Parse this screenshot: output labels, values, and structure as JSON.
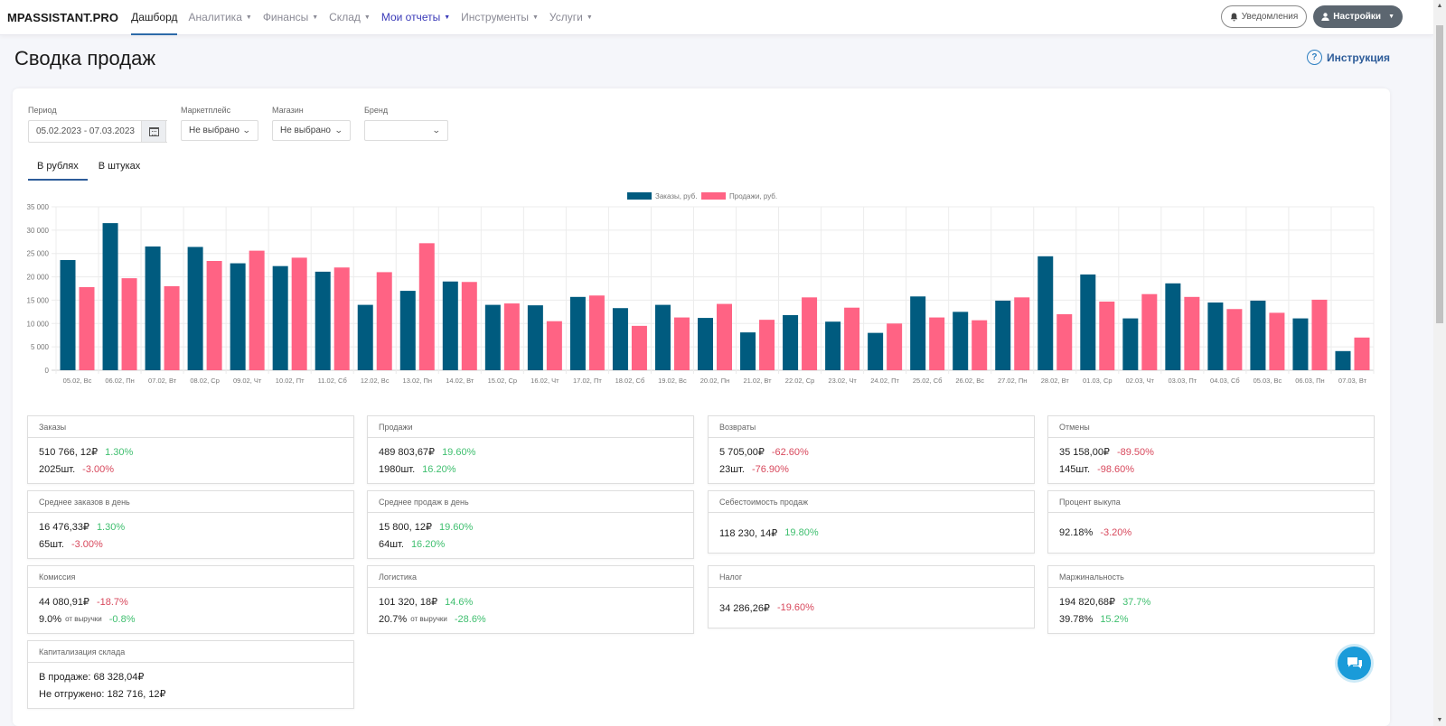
{
  "navbar": {
    "brand": "MPASSISTANT.PRO",
    "items": [
      {
        "label": "Дашборд",
        "dropdown": false,
        "state": "active"
      },
      {
        "label": "Аналитика",
        "dropdown": true,
        "state": ""
      },
      {
        "label": "Финансы",
        "dropdown": true,
        "state": ""
      },
      {
        "label": "Склад",
        "dropdown": true,
        "state": ""
      },
      {
        "label": "Мои отчеты",
        "dropdown": true,
        "state": "highlight"
      },
      {
        "label": "Инструменты",
        "dropdown": true,
        "state": ""
      },
      {
        "label": "Услуги",
        "dropdown": true,
        "state": ""
      }
    ],
    "notifications_label": "Уведомления",
    "settings_label": "Настройки"
  },
  "page": {
    "title": "Сводка продаж",
    "help_label": "Инструкция"
  },
  "filters": {
    "period_label": "Период",
    "period_value": "05.02.2023 - 07.03.2023",
    "marketplace_label": "Маркетплейс",
    "marketplace_value": "Не выбрано",
    "shop_label": "Магазин",
    "shop_value": "Не выбрано",
    "brand_label": "Бренд",
    "brand_value": ""
  },
  "tabs": [
    {
      "label": "В рублях",
      "active": true
    },
    {
      "label": "В штуках",
      "active": false
    }
  ],
  "chart_data": {
    "type": "bar",
    "title": "",
    "xlabel": "",
    "ylabel": "",
    "ylim": [
      0,
      35000
    ],
    "yticks": [
      0,
      5000,
      10000,
      15000,
      20000,
      25000,
      30000,
      35000
    ],
    "ytick_labels": [
      "0",
      "5 000",
      "10 000",
      "15 000",
      "20 000",
      "25 000",
      "30 000",
      "35 000"
    ],
    "grid": true,
    "legend_position": "top-center",
    "categories": [
      "05.02, Вс",
      "06.02, Пн",
      "07.02, Вт",
      "08.02, Ср",
      "09.02, Чт",
      "10.02, Пт",
      "11.02, Сб",
      "12.02, Вс",
      "13.02, Пн",
      "14.02, Вт",
      "15.02, Ср",
      "16.02, Чт",
      "17.02, Пт",
      "18.02, Сб",
      "19.02, Вс",
      "20.02, Пн",
      "21.02, Вт",
      "22.02, Ср",
      "23.02, Чт",
      "24.02, Пт",
      "25.02, Сб",
      "26.02, Вс",
      "27.02, Пн",
      "28.02, Вт",
      "01.03, Ср",
      "02.03, Чт",
      "03.03, Пт",
      "04.03, Сб",
      "05.03, Вс",
      "06.03, Пн",
      "07.03, Вт"
    ],
    "series": [
      {
        "name": "Заказы, руб.",
        "color": "#005b7f",
        "values": [
          23600,
          31500,
          26500,
          26400,
          22900,
          22300,
          21100,
          14000,
          17000,
          19000,
          14000,
          13900,
          15700,
          13300,
          14000,
          11200,
          8100,
          11800,
          10400,
          8000,
          15800,
          12500,
          14900,
          24400,
          20500,
          11100,
          18600,
          14500,
          14900,
          11100,
          4100
        ]
      },
      {
        "name": "Продажи, руб.",
        "color": "#ff6384",
        "values": [
          17800,
          19700,
          18000,
          23400,
          25600,
          24100,
          22000,
          21000,
          27200,
          18900,
          14300,
          10500,
          16000,
          9500,
          11300,
          14200,
          10800,
          15600,
          13400,
          10000,
          11300,
          10700,
          15600,
          12000,
          14700,
          16300,
          15700,
          13100,
          12300,
          15100,
          7000
        ]
      }
    ]
  },
  "cards": {
    "orders": {
      "title": "Заказы",
      "rub": "510 766, 12₽",
      "rub_change": "1.30%",
      "qty": "2025шт.",
      "qty_change": "-3.00%"
    },
    "sales": {
      "title": "Продажи",
      "rub": "489 803,67₽",
      "rub_change": "19.60%",
      "qty": "1980шт.",
      "qty_change": "16.20%"
    },
    "returns": {
      "title": "Возвраты",
      "rub": "5 705,00₽",
      "rub_change": "-62.60%",
      "qty": "23шт.",
      "qty_change": "-76.90%"
    },
    "cancels": {
      "title": "Отмены",
      "rub": "35 158,00₽",
      "rub_change": "-89.50%",
      "qty": "145шт.",
      "qty_change": "-98.60%"
    },
    "avg_orders": {
      "title": "Среднее заказов в день",
      "rub": "16 476,33₽",
      "rub_change": "1.30%",
      "qty": "65шт.",
      "qty_change": "-3.00%"
    },
    "avg_sales": {
      "title": "Среднее продаж в день",
      "rub": "15 800, 12₽",
      "rub_change": "19.60%",
      "qty": "64шт.",
      "qty_change": "16.20%"
    },
    "cost": {
      "title": "Себестоимость продаж",
      "rub": "118 230, 14₽",
      "rub_change": "19.80%"
    },
    "buyout": {
      "title": "Процент выкупа",
      "value": "92.18%",
      "change": "-3.20%"
    },
    "commission": {
      "title": "Комиссия",
      "rub": "44 080,91₽",
      "rub_change": "-18.7%",
      "pct": "9.0%",
      "pct_note": "от выручки",
      "pct_change": "-0.8%"
    },
    "logistics": {
      "title": "Логистика",
      "rub": "101 320, 18₽",
      "rub_change": "14.6%",
      "pct": "20.7%",
      "pct_note": "от выручки",
      "pct_change": "-28.6%"
    },
    "tax": {
      "title": "Налог",
      "rub": "34 286,26₽",
      "rub_change": "-19.60%"
    },
    "margin": {
      "title": "Маржинальность",
      "rub": "194 820,68₽",
      "rub_change": "37.7%",
      "pct": "39.78%",
      "pct_change": "15.2%"
    },
    "stock": {
      "title": "Капитализация склада",
      "on_sale": "В продаже: 68 328,04₽",
      "not_shipped": "Не отгружено: 182 716, 12₽"
    }
  },
  "colors": {
    "accent": "#2d5c99",
    "positive": "#3fbf6f",
    "negative": "#d8485c",
    "chat": "#1a9bd9"
  }
}
